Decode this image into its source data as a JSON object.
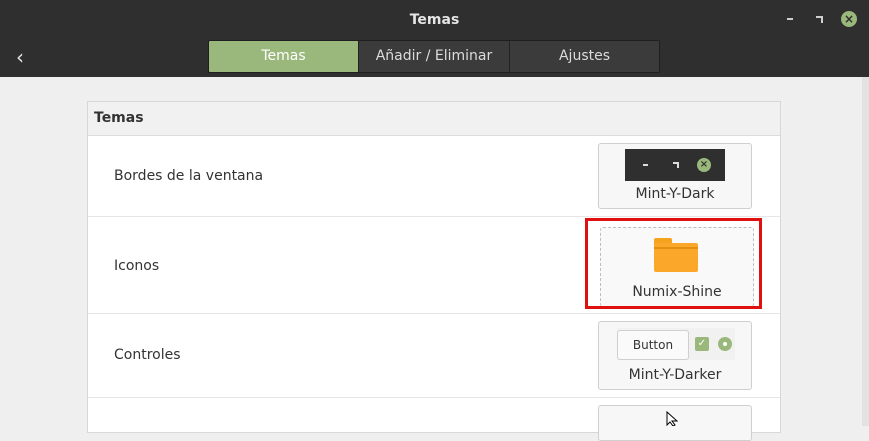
{
  "window": {
    "title": "Temas"
  },
  "tabs": [
    {
      "label": "Temas"
    },
    {
      "label": "Añadir / Eliminar"
    },
    {
      "label": "Ajustes"
    }
  ],
  "panel": {
    "title": "Temas"
  },
  "rows": [
    {
      "label": "Bordes de la ventana",
      "value": "Mint-Y-Dark"
    },
    {
      "label": "Iconos",
      "value": "Numix-Shine"
    },
    {
      "label": "Controles",
      "value": "Mint-Y-Darker",
      "preview_button": "Button"
    }
  ],
  "colors": {
    "accent": "#9ab87c",
    "highlight": "#e01010",
    "header": "#2f2f2f"
  }
}
